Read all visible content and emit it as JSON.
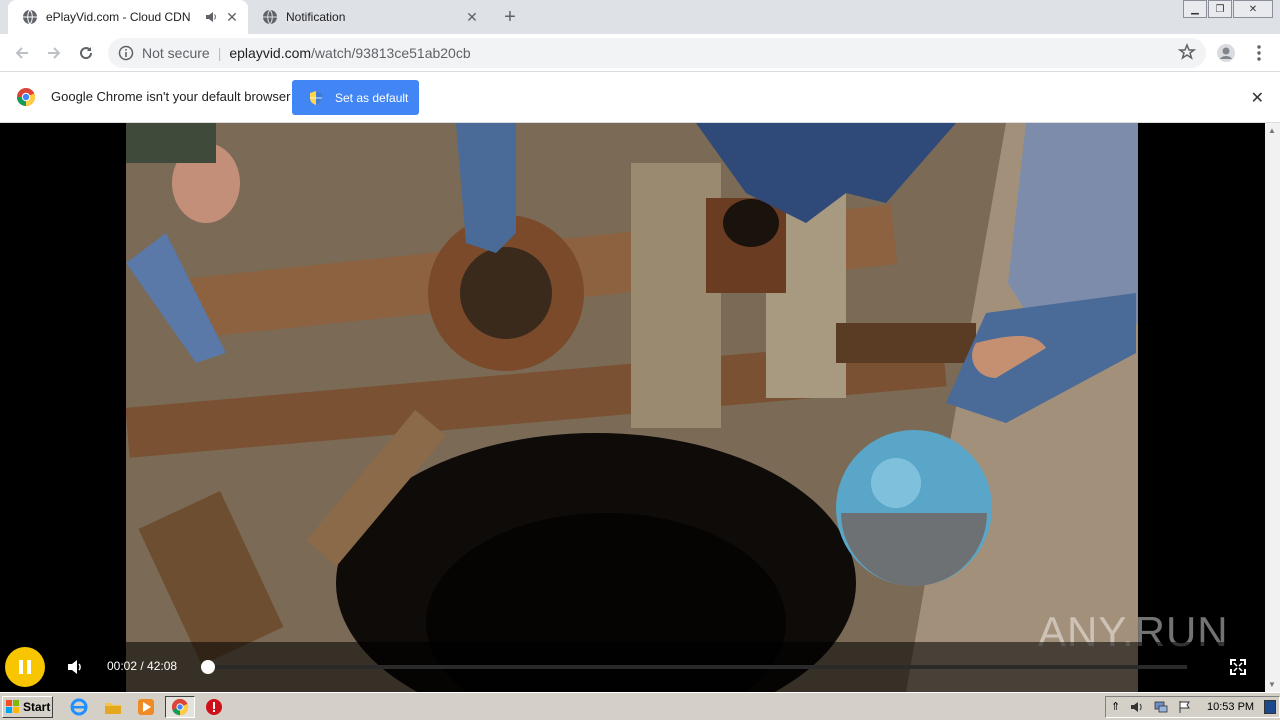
{
  "tabs": [
    {
      "title": "ePlayVid.com - Cloud CDN",
      "active": true,
      "icon": "globe-icon",
      "audio": "speaker-icon"
    },
    {
      "title": "Notification",
      "active": false,
      "icon": "globe-icon"
    }
  ],
  "omnibox": {
    "security": "Not secure",
    "host": "eplayvid.com",
    "path": "/watch/93813ce51ab20cb"
  },
  "infobar": {
    "message": "Google Chrome isn't your default browser",
    "button": "Set as default"
  },
  "player": {
    "time": "00:02 / 42:08",
    "progress": 0.001,
    "state": "playing",
    "accent": "#f7c600"
  },
  "watermark": "ANY.RUN",
  "taskbar": {
    "start": "Start",
    "clock": "10:53 PM"
  }
}
